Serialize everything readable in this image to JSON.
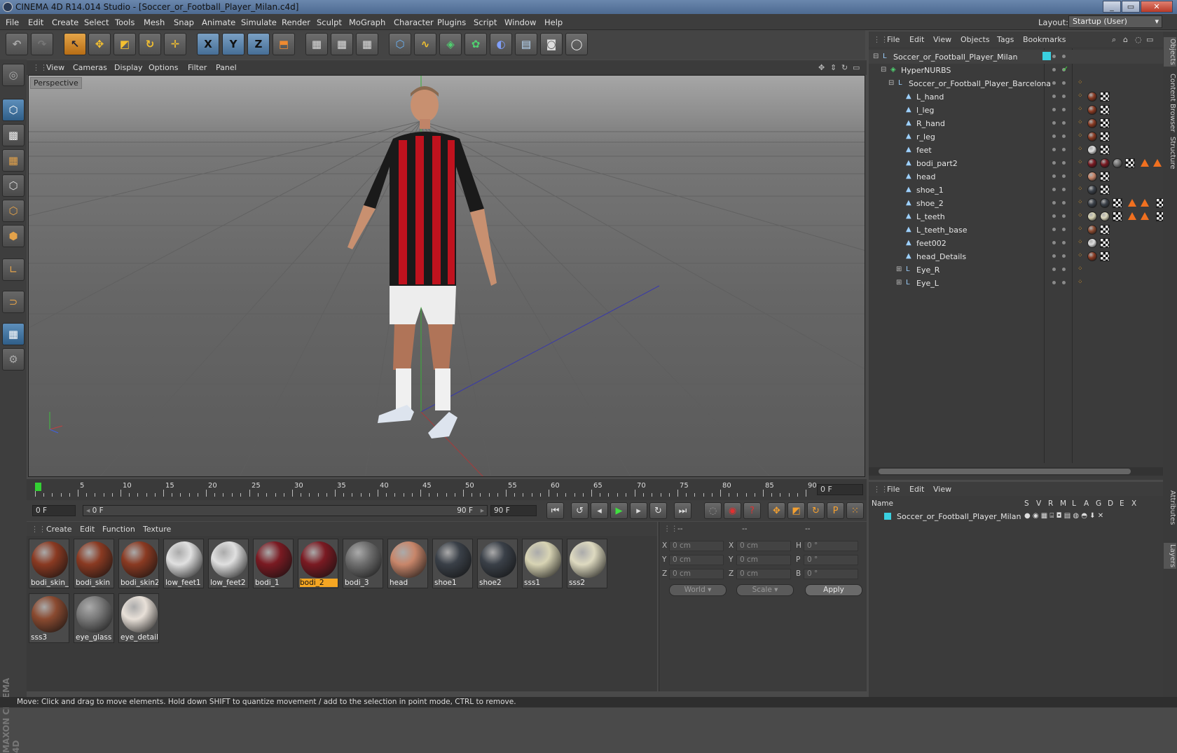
{
  "window": {
    "title": "CINEMA 4D R14.014 Studio - [Soccer_or_Football_Player_Milan.c4d]",
    "min": "_",
    "max": "▭",
    "close": "✕"
  },
  "menubar": {
    "items": [
      "File",
      "Edit",
      "Create",
      "Select",
      "Tools",
      "Mesh",
      "Snap",
      "Animate",
      "Simulate",
      "Render",
      "Sculpt",
      "MoGraph",
      "Character",
      "Plugins",
      "Script",
      "Window",
      "Help"
    ],
    "layout_label": "Layout:",
    "layout_value": "Startup (User)"
  },
  "toolbar": {
    "axis_x": "X",
    "axis_y": "Y",
    "axis_z": "Z"
  },
  "viewport": {
    "menu": [
      "View",
      "Cameras",
      "Display",
      "Options",
      "Filter",
      "Panel"
    ],
    "camera_label": "Perspective"
  },
  "timeline": {
    "ticks": [
      "0",
      "5",
      "10",
      "15",
      "20",
      "25",
      "30",
      "35",
      "40",
      "45",
      "50",
      "55",
      "60",
      "65",
      "70",
      "75",
      "80",
      "85",
      "90"
    ],
    "current_frame": "0 F"
  },
  "transport": {
    "start": "0 F",
    "range_start": "0 F",
    "range_end": "90 F",
    "end": "90 F"
  },
  "materials": {
    "menu": [
      "Create",
      "Edit",
      "Function",
      "Texture"
    ],
    "items": [
      {
        "label": "bodi_skin_",
        "color": "#8a3a22"
      },
      {
        "label": "bodi_skin",
        "color": "#8a3a22"
      },
      {
        "label": "bodi_skin2",
        "color": "#8a3a22"
      },
      {
        "label": "low_feet1",
        "color": "#e0e0e0"
      },
      {
        "label": "low_feet2",
        "color": "#e0e0e0"
      },
      {
        "label": "bodi_1",
        "color": "#7a1a22"
      },
      {
        "label": "bodi_2",
        "color": "#7a1a22",
        "selected": true
      },
      {
        "label": "bodi_3",
        "color": "#6e6e6e"
      },
      {
        "label": "head",
        "color": "#c8866a"
      },
      {
        "label": "shoe1",
        "color": "#3a4048"
      },
      {
        "label": "shoe2",
        "color": "#3a4048"
      },
      {
        "label": "sss1",
        "color": "#d8d4b4"
      },
      {
        "label": "sss2",
        "color": "#dedac0"
      },
      {
        "label": "sss3",
        "color": "#8a4a30"
      },
      {
        "label": "eye_glass",
        "color": "#7a7a7a"
      },
      {
        "label": "eye_details",
        "color": "#e8e0d8"
      }
    ]
  },
  "coords": {
    "headers": [
      "--",
      "--",
      "--"
    ],
    "rows": [
      {
        "a": "X",
        "av": "0 cm",
        "b": "X",
        "bv": "0 cm",
        "c": "H",
        "cv": "0 °"
      },
      {
        "a": "Y",
        "av": "0 cm",
        "b": "Y",
        "bv": "0 cm",
        "c": "P",
        "cv": "0 °"
      },
      {
        "a": "Z",
        "av": "0 cm",
        "b": "Z",
        "bv": "0 cm",
        "c": "B",
        "cv": "0 °"
      }
    ],
    "space": "World",
    "mode": "Scale",
    "apply": "Apply"
  },
  "objects": {
    "menu": [
      "File",
      "Edit",
      "View",
      "Objects",
      "Tags",
      "Bookmarks"
    ],
    "tree": [
      {
        "name": "Soccer_or_Football_Player_Milan",
        "level": 0
      },
      {
        "name": "HyperNURBS",
        "level": 1
      },
      {
        "name": "Soccer_or_Football_Player_Barcelona",
        "level": 2
      },
      {
        "name": "L_hand",
        "level": 3
      },
      {
        "name": "l_leg",
        "level": 3
      },
      {
        "name": "R_hand",
        "level": 3
      },
      {
        "name": "r_leg",
        "level": 3
      },
      {
        "name": "feet",
        "level": 3
      },
      {
        "name": "bodi_part2",
        "level": 3
      },
      {
        "name": "head",
        "level": 3
      },
      {
        "name": "shoe_1",
        "level": 3
      },
      {
        "name": "shoe_2",
        "level": 3
      },
      {
        "name": "L_teeth",
        "level": 3
      },
      {
        "name": "L_teeth_base",
        "level": 3
      },
      {
        "name": "feet002",
        "level": 3
      },
      {
        "name": "head_Details",
        "level": 3
      },
      {
        "name": "Eye_R",
        "level": 3
      },
      {
        "name": "Eye_L",
        "level": 3
      }
    ]
  },
  "layers": {
    "menu": [
      "File",
      "Edit",
      "View"
    ],
    "header_name": "Name",
    "header_cols": [
      "S",
      "V",
      "R",
      "M",
      "L",
      "A",
      "G",
      "D",
      "E",
      "X"
    ],
    "row": "Soccer_or_Football_Player_Milan"
  },
  "side_tabs": [
    "Objects",
    "Content Browser",
    "Structure",
    "Attributes",
    "Layers"
  ],
  "brand": "MAXON CINEMA 4D",
  "status": "Move: Click and drag to move elements. Hold down SHIFT to quantize movement / add to the selection in point mode, CTRL to remove."
}
